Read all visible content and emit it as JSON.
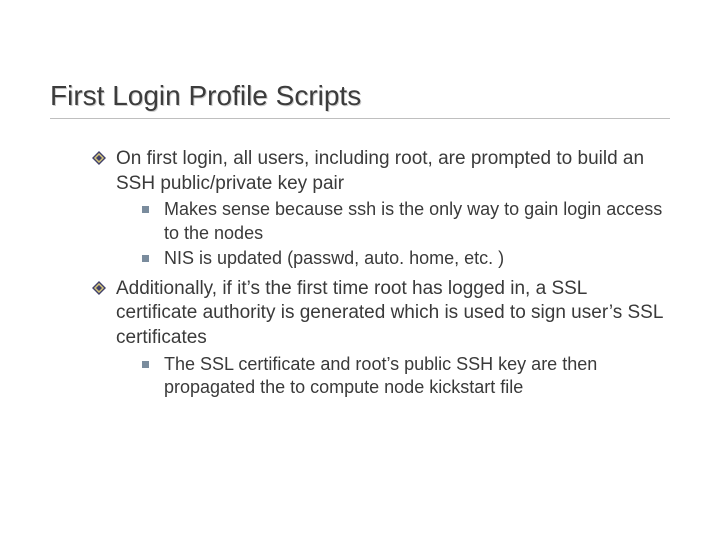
{
  "title": "First Login Profile Scripts",
  "items": [
    {
      "text": "On first login, all users, including root, are prompted to build an SSH public/private key pair",
      "sub": [
        "Makes sense because ssh is the only way to gain login access to the nodes",
        "NIS is updated (passwd, auto. home, etc. )"
      ]
    },
    {
      "text": "Additionally, if it’s the first time root has logged in, a SSL certificate authority is generated which is used to sign user’s SSL certificates",
      "sub": [
        "The SSL certificate and root’s public SSH key are then propagated the to compute node kickstart file"
      ]
    }
  ]
}
